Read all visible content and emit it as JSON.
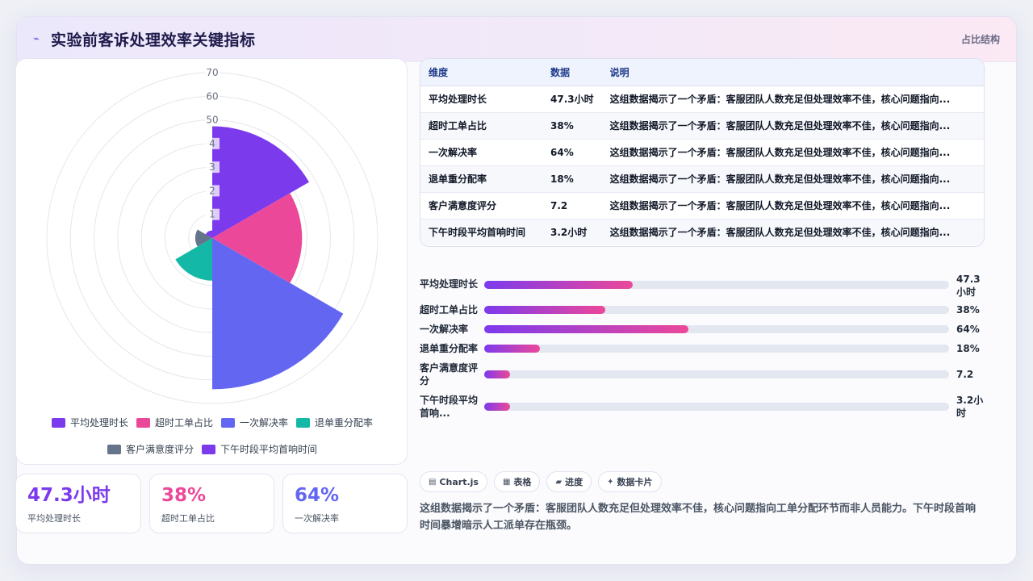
{
  "header": {
    "title": "实验前客诉处理效率关键指标",
    "right_label": "占比结构",
    "logo_icon": "sparkle-icon"
  },
  "chart_data": {
    "type": "polar-area",
    "categories": [
      "平均处理时长",
      "超时工单占比",
      "一次解决率",
      "退单重分配率",
      "客户满意度评分",
      "下午时段平均首响时间"
    ],
    "values": [
      47.3,
      38,
      64,
      18,
      7.2,
      3.2
    ],
    "colors": [
      "#7c3aed",
      "#ec4899",
      "#6366f1",
      "#14b8a6",
      "#64748b",
      "#7c3aed"
    ],
    "r_ticks": [
      "1",
      "2",
      "3",
      "4",
      "50",
      "60",
      "70"
    ],
    "rlim": [
      0,
      70
    ],
    "legend_position": "bottom"
  },
  "kpis": [
    {
      "value": "47.3小时",
      "label": "平均处理时长",
      "color": "#7c3aed"
    },
    {
      "value": "38%",
      "label": "超时工单占比",
      "color": "#ec4899"
    },
    {
      "value": "64%",
      "label": "一次解决率",
      "color": "#6366f1"
    }
  ],
  "table": {
    "headers": [
      "维度",
      "数据",
      "说明"
    ],
    "rows": [
      {
        "dim": "平均处理时长",
        "val": "47.3小时",
        "desc": "这组数据揭示了一个矛盾：客服团队人数充足但处理效率不佳，核心问题指向..."
      },
      {
        "dim": "超时工单占比",
        "val": "38%",
        "desc": "这组数据揭示了一个矛盾：客服团队人数充足但处理效率不佳，核心问题指向..."
      },
      {
        "dim": "一次解决率",
        "val": "64%",
        "desc": "这组数据揭示了一个矛盾：客服团队人数充足但处理效率不佳，核心问题指向..."
      },
      {
        "dim": "退单重分配率",
        "val": "18%",
        "desc": "这组数据揭示了一个矛盾：客服团队人数充足但处理效率不佳，核心问题指向..."
      },
      {
        "dim": "客户满意度评分",
        "val": "7.2",
        "desc": "这组数据揭示了一个矛盾：客服团队人数充足但处理效率不佳，核心问题指向..."
      },
      {
        "dim": "下午时段平均首响时间",
        "val": "3.2小时",
        "desc": "这组数据揭示了一个矛盾：客服团队人数充足但处理效率不佳，核心问题指向..."
      }
    ]
  },
  "bars": [
    {
      "label_line1": "平均处理时长",
      "label_line2": "",
      "value_line1": "47.3",
      "value_line2": "小时",
      "fill": 0.32
    },
    {
      "label_line1": "超时工单占比",
      "label_line2": "",
      "value_line1": "38%",
      "value_line2": "",
      "fill": 0.26
    },
    {
      "label_line1": "一次解决率",
      "label_line2": "",
      "value_line1": "64%",
      "value_line2": "",
      "fill": 0.44
    },
    {
      "label_line1": "退单重分配率",
      "label_line2": "",
      "value_line1": "18%",
      "value_line2": "",
      "fill": 0.12
    },
    {
      "label_line1": "客户满意度评",
      "label_line2": "分",
      "value_line1": "7.2",
      "value_line2": "",
      "fill": 0.055
    },
    {
      "label_line1": "下午时段平均",
      "label_line2": "首响...",
      "value_line1": "3.2小",
      "value_line2": "时",
      "fill": 0.055
    }
  ],
  "chips": [
    {
      "icon": "chart-icon",
      "glyph": "▤",
      "label": "Chart.js"
    },
    {
      "icon": "table-icon",
      "glyph": "▦",
      "label": "表格"
    },
    {
      "icon": "progress-icon",
      "glyph": "▰",
      "label": "进度"
    },
    {
      "icon": "sparkle-icon",
      "glyph": "✦",
      "label": "数据卡片"
    }
  ],
  "summary": "这组数据揭示了一个矛盾：客服团队人数充足但处理效率不佳，核心问题指向工单分配环节而非人员能力。下午时段首响时间暴增暗示人工派单存在瓶颈。"
}
